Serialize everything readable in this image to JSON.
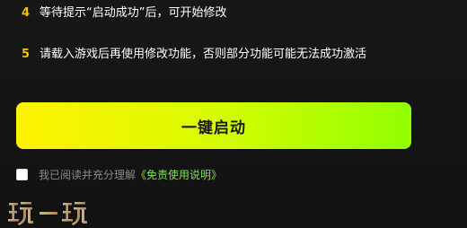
{
  "steps": [
    {
      "number": "4",
      "text": "等待提示“启动成功”后，可开始修改"
    },
    {
      "number": "5",
      "text": "请载入游戏后再使用修改功能，否则部分功能可能无法成功激活"
    }
  ],
  "start_button": {
    "label": "一键启动"
  },
  "agreement": {
    "text": "我已阅读并充分理解",
    "link_text": "《免责使用说明》",
    "checked": false
  },
  "watermark": {
    "text": "玩一玩"
  },
  "colors": {
    "background": "#141414",
    "step_number": "#f2c200",
    "button_start": "#fff200",
    "button_end": "#90ff00",
    "link": "#7ee54a"
  }
}
